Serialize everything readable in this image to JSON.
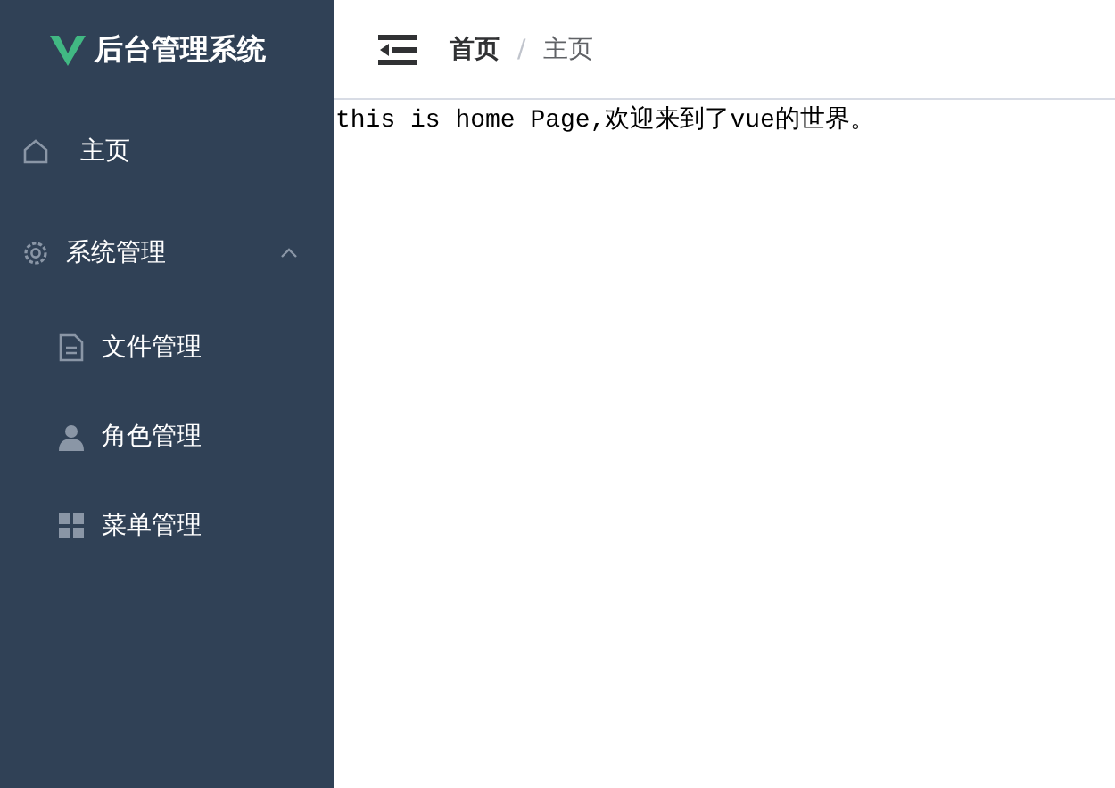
{
  "sidebar": {
    "title": "后台管理系统",
    "items": [
      {
        "label": "主页"
      },
      {
        "label": "系统管理",
        "expanded": true,
        "children": [
          {
            "label": "文件管理"
          },
          {
            "label": "角色管理"
          },
          {
            "label": "菜单管理"
          }
        ]
      }
    ]
  },
  "breadcrumb_separator": "/",
  "breadcrumb": [
    {
      "label": "首页",
      "current": false
    },
    {
      "label": "主页",
      "current": true
    }
  ],
  "content": {
    "text": "this is home Page,欢迎来到了vue的世界。"
  }
}
